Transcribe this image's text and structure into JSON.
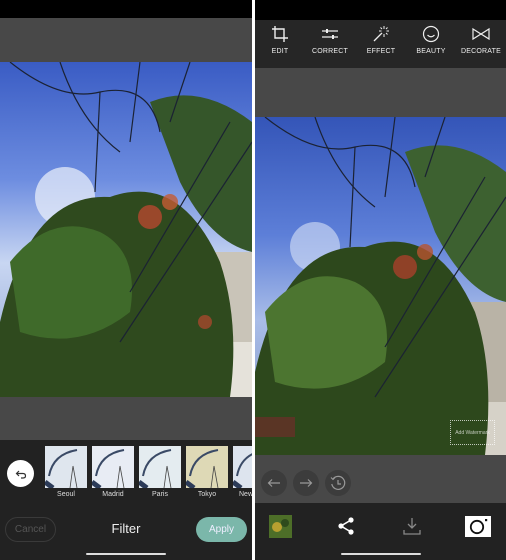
{
  "left_screen": {
    "filter_panel": {
      "title": "Filter",
      "cancel_label": "Cancel",
      "apply_label": "Apply",
      "undo_icon": "undo-icon",
      "filters": [
        {
          "label": "Seoul",
          "tint": "#dfe6ee"
        },
        {
          "label": "Madrid",
          "tint": "#e8ecf4"
        },
        {
          "label": "Paris",
          "tint": "#e4ecf0"
        },
        {
          "label": "Tokyo",
          "tint": "#ded9b6"
        },
        {
          "label": "New",
          "tint": "#dde4ee"
        }
      ],
      "accent_color": "#7bb7aa"
    }
  },
  "right_screen": {
    "toolbar": [
      {
        "label": "EDIT",
        "icon": "crop-icon"
      },
      {
        "label": "CORRECT",
        "icon": "sliders-icon"
      },
      {
        "label": "EFFECT",
        "icon": "magic-wand-icon"
      },
      {
        "label": "BEAUTY",
        "icon": "smiley-icon"
      },
      {
        "label": "DECORATE",
        "icon": "bowtie-icon"
      }
    ],
    "history": [
      "undo-arrow-icon",
      "redo-arrow-icon",
      "history-icon"
    ],
    "bottom_actions": [
      "gallery-thumbnail",
      "share-icon",
      "download-icon",
      "camera-icon"
    ],
    "watermark_text": "Add Watermark"
  }
}
